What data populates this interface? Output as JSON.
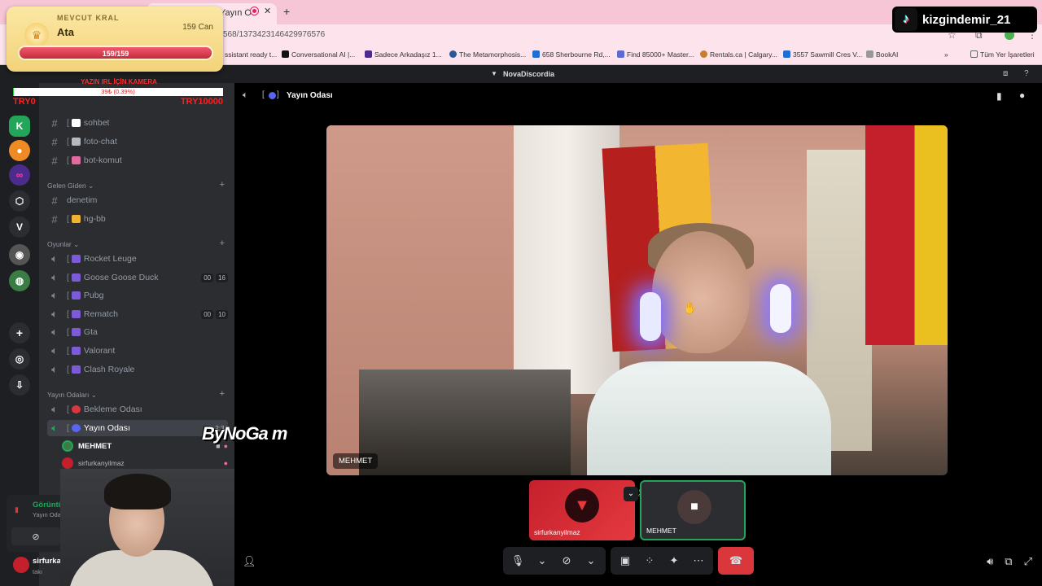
{
  "browser": {
    "tab_title": "Yayın Od",
    "url": "568/1373423146429976576",
    "bookmarks": [
      {
        "label": "ssistant ready t...",
        "color": "#888"
      },
      {
        "label": "Conversational AI |...",
        "color": "#111"
      },
      {
        "label": "Sadece Arkadaşız 1...",
        "color": "#4b2c8c"
      },
      {
        "label": "The Metamorphosis...",
        "color": "#2b5797"
      },
      {
        "label": "658 Sherbourne Rd,...",
        "color": "#1f6ed4"
      },
      {
        "label": "Find 85000+ Master...",
        "color": "#5a6bd1"
      },
      {
        "label": "Rentals.ca | Calgary...",
        "color": "#c77d2a"
      },
      {
        "label": "3557 Sawmill Cres V...",
        "color": "#1f6ed4"
      },
      {
        "label": "BookAI",
        "color": "#444"
      }
    ],
    "all_bookmarks": "Tüm Yer İşaretleri"
  },
  "discord": {
    "server_name": "NovaDiscordia",
    "channel_title": "Yayın Odası",
    "text_channels": [
      {
        "name": "sohbet",
        "color": "#ffffff"
      },
      {
        "name": "foto-chat",
        "color": "#b5bac1"
      },
      {
        "name": "bot-komut",
        "color": "#e06c9f"
      }
    ],
    "cat_gelen": "Gelen Giden",
    "gelen_channels": [
      {
        "name": "denetim",
        "plain": true
      },
      {
        "name": "hg-bb",
        "color": "#f0b232"
      }
    ],
    "cat_oyunlar": "Oyunlar",
    "game_channels": [
      {
        "name": "Rocket Leuge",
        "a": "",
        "b": ""
      },
      {
        "name": "Goose Goose Duck",
        "a": "00",
        "b": "16"
      },
      {
        "name": "Pubg",
        "a": "",
        "b": ""
      },
      {
        "name": "Rematch",
        "a": "00",
        "b": "10"
      },
      {
        "name": "Gta",
        "a": "",
        "b": ""
      },
      {
        "name": "Valorant",
        "a": "",
        "b": ""
      },
      {
        "name": "Clash Royale",
        "a": "",
        "b": ""
      }
    ],
    "cat_yayin": "Yayın Odaları",
    "yayin_channels": [
      {
        "name": "Bekleme Odası",
        "color": "#da373c"
      },
      {
        "name": "Yayın Odası",
        "color": "#5865f2",
        "time": "2:33"
      }
    ],
    "voice_users": [
      "MEHMET",
      "sirfurkanyilmaz"
    ],
    "voice_status": "Görüntülü Bağlantı",
    "voice_sub": "Yayın Odası / NovaD",
    "self_name": "sirfurkany",
    "self_sub": "takı"
  },
  "stream": {
    "king_label": "MEVCUT KRAL",
    "king_name": "Ata",
    "king_hp_text": "159 Can",
    "king_bar_text": "159/159",
    "king_hp_fraction": 1.0,
    "goal_title": "YAZIN IRL İÇİN KAMERA",
    "goal_text": "39₺ (0.39%)",
    "goal_fraction": 0.0039,
    "goal_min": "TRY0",
    "goal_max": "TRY10000",
    "tiktok_name": "kizgindemir_21",
    "watermark": "ByNoGa m"
  },
  "video": {
    "main_label": "MEHMET",
    "thumb1_label": "sirfurkanyilmaz",
    "thumb2_label": "MEHMET"
  },
  "colors": {
    "accent": "#5865f2",
    "danger": "#da373c",
    "online": "#23a55a"
  }
}
